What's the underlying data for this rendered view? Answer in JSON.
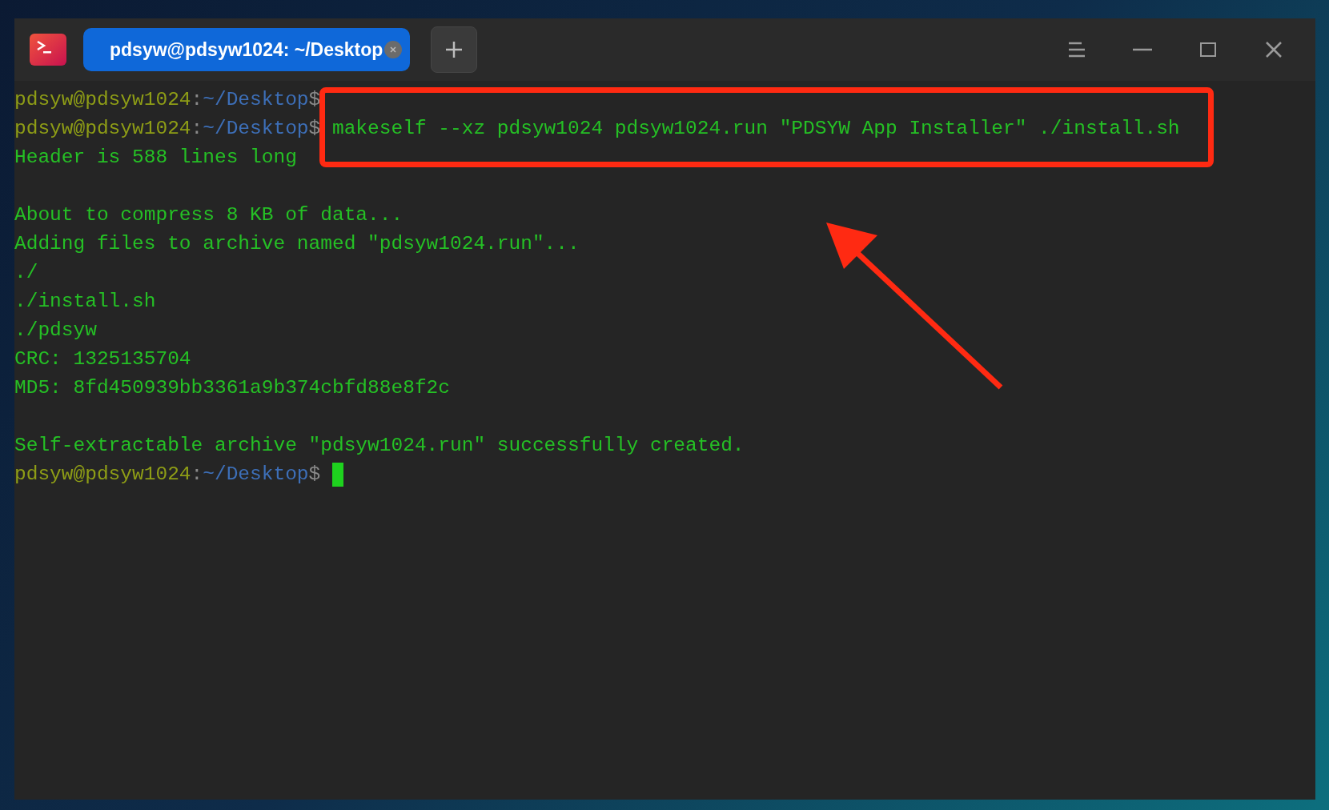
{
  "window": {
    "tab": {
      "title": "pdsyw@pdsyw1024: ~/Desktop",
      "selected": true
    }
  },
  "terminal": {
    "lines": [
      {
        "kind": "prompt",
        "user_host": "pdsyw@pdsyw1024",
        "separator": ":",
        "path": "~/Desktop",
        "symbol": "$"
      },
      {
        "kind": "prompt",
        "user_host": "pdsyw@pdsyw1024",
        "separator": ":",
        "path": "~/Desktop",
        "symbol": "$",
        "command": "makeself --xz pdsyw1024 pdsyw1024.run \"PDSYW App Installer\" ./install.sh",
        "highlighted": true
      },
      {
        "kind": "output",
        "text": "Header is 588 lines long"
      },
      {
        "kind": "blank"
      },
      {
        "kind": "output",
        "text": "About to compress 8 KB of data..."
      },
      {
        "kind": "output",
        "text": "Adding files to archive named \"pdsyw1024.run\"..."
      },
      {
        "kind": "output",
        "text": "./"
      },
      {
        "kind": "output",
        "text": "./install.sh"
      },
      {
        "kind": "output",
        "text": "./pdsyw"
      },
      {
        "kind": "output",
        "text": "CRC: 1325135704"
      },
      {
        "kind": "output",
        "text": "MD5: 8fd450939bb3361a9b374cbfd88e8f2c"
      },
      {
        "kind": "blank"
      },
      {
        "kind": "output",
        "text": "Self-extractable archive \"pdsyw1024.run\" successfully created."
      },
      {
        "kind": "prompt",
        "user_host": "pdsyw@pdsyw1024",
        "separator": ":",
        "path": "~/Desktop",
        "symbol": "$",
        "cursor": true
      }
    ]
  }
}
